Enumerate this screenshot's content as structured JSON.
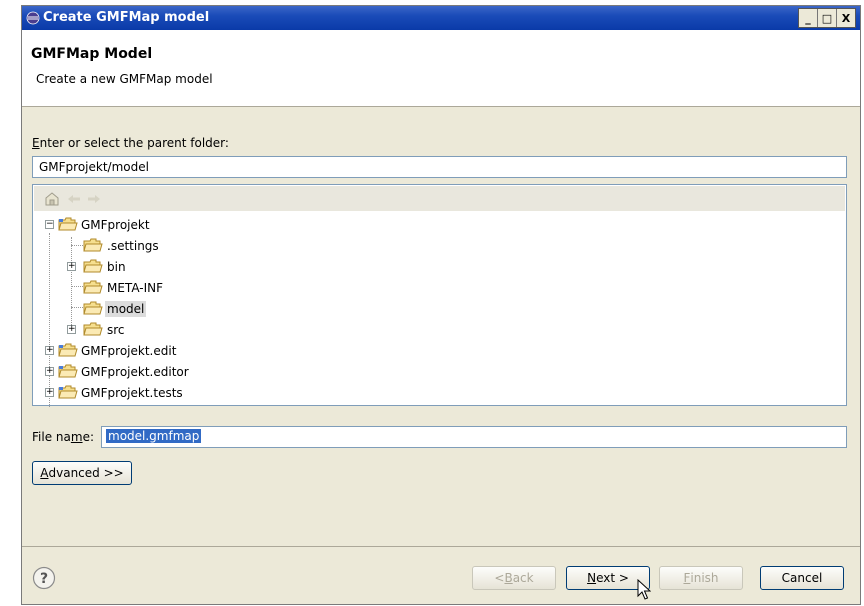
{
  "window": {
    "title": "Create GMFMap model",
    "controls": {
      "minimize": "_",
      "maximize": "□",
      "close": "X"
    }
  },
  "header": {
    "title": "GMFMap Model",
    "description": "Create a new GMFMap model"
  },
  "parent_folder": {
    "label_mnemonic": "E",
    "label_rest": "nter or select the parent folder:",
    "value": "GMFprojekt/model"
  },
  "tree": {
    "toolbar_icons": [
      "home-icon",
      "back-arrow-icon",
      "forward-arrow-icon"
    ],
    "items": [
      {
        "label": "GMFprojekt",
        "level": 0,
        "expander": "−"
      },
      {
        "label": ".settings",
        "level": 1,
        "expander": ""
      },
      {
        "label": "bin",
        "level": 1,
        "expander": "+"
      },
      {
        "label": "META-INF",
        "level": 1,
        "expander": ""
      },
      {
        "label": "model",
        "level": 1,
        "expander": "",
        "selected": true
      },
      {
        "label": "src",
        "level": 1,
        "expander": "+"
      },
      {
        "label": "GMFprojekt.edit",
        "level": 0,
        "expander": "+"
      },
      {
        "label": "GMFprojekt.editor",
        "level": 0,
        "expander": "+"
      },
      {
        "label": "GMFprojekt.tests",
        "level": 0,
        "expander": "+"
      }
    ]
  },
  "file_name": {
    "label_prefix": "File na",
    "label_mnemonic": "m",
    "label_suffix": "e:",
    "value": "model.gmfmap"
  },
  "advanced_button": {
    "mnemonic": "A",
    "rest": "dvanced >>"
  },
  "buttons": {
    "back": {
      "prefix": "< ",
      "mnemonic": "B",
      "rest": "ack",
      "enabled": false
    },
    "next": {
      "mnemonic": "N",
      "rest": "ext >",
      "enabled": true
    },
    "finish": {
      "mnemonic": "F",
      "rest": "inish",
      "enabled": false
    },
    "cancel": {
      "label": "Cancel",
      "enabled": true
    }
  },
  "colors": {
    "title_bar": "#0a3aa8",
    "selection": "#316ac5",
    "dialog_bg": "#ece9d8"
  }
}
